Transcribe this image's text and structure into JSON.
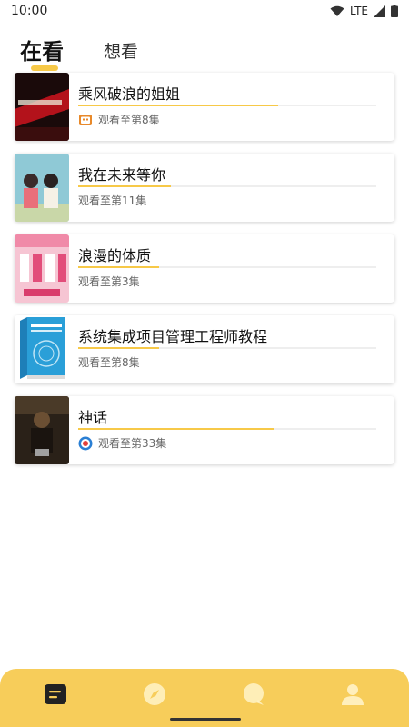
{
  "status_bar": {
    "time": "10:00",
    "network": "LTE"
  },
  "tabs": [
    {
      "label": "在看",
      "active": true
    },
    {
      "label": "想看",
      "active": false
    }
  ],
  "shows": [
    {
      "title": "乘风破浪的姐姐",
      "progress_text": "观看至第8集",
      "progress_fraction": 0.67,
      "source_icon": "bilibili-tv-icon"
    },
    {
      "title": "我在未来等你",
      "progress_text": "观看至第11集",
      "progress_fraction": 0.31,
      "source_icon": "none"
    },
    {
      "title": "浪漫的体质",
      "progress_text": "观看至第3集",
      "progress_fraction": 0.27,
      "source_icon": "none"
    },
    {
      "title": "系统集成项目管理工程师教程",
      "progress_text": "观看至第8集",
      "progress_fraction": 0.27,
      "source_icon": "none"
    },
    {
      "title": "神话",
      "progress_text": "观看至第33集",
      "progress_fraction": 0.66,
      "source_icon": "target-app-icon"
    }
  ],
  "bottom_nav": [
    {
      "name": "list-icon",
      "active": true
    },
    {
      "name": "compass-icon",
      "active": false
    },
    {
      "name": "chat-icon",
      "active": false
    },
    {
      "name": "profile-icon",
      "active": false
    }
  ],
  "colors": {
    "accent": "#f7c948",
    "nav_bar": "#f7cd5a",
    "track": "#eeeeee"
  }
}
